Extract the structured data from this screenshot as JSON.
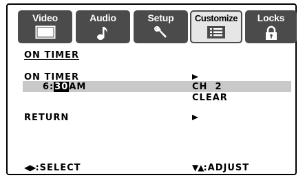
{
  "tabs": [
    {
      "label": "Video",
      "icon": "tv-screen-icon",
      "selected": false
    },
    {
      "label": "Audio",
      "icon": "music-note-icon",
      "selected": false
    },
    {
      "label": "Setup",
      "icon": "wrench-icon",
      "selected": false
    },
    {
      "label": "Customize",
      "icon": "list-icon",
      "selected": true
    },
    {
      "label": "Locks",
      "icon": "padlock-icon",
      "selected": false
    }
  ],
  "screen": {
    "heading": "ON TIMER",
    "rows": {
      "on_timer_label": "ON TIMER",
      "time_hour": "6:",
      "time_minutes": "30",
      "time_ampm": "AM",
      "channel": "CH  2",
      "clear": "CLEAR",
      "return_label": "RETURN"
    }
  },
  "footer": {
    "select_glyph": "◀▶",
    "select_label": ":SELECT",
    "adjust_glyph": "▼▲",
    "adjust_label": ":ADJUST"
  },
  "colors": {
    "tab_bg": "#4b4b4b",
    "tab_selected_bg": "#e6e6e6",
    "highlight_row": "#c9c9c9",
    "text": "#000000",
    "background": "#ffffff"
  }
}
